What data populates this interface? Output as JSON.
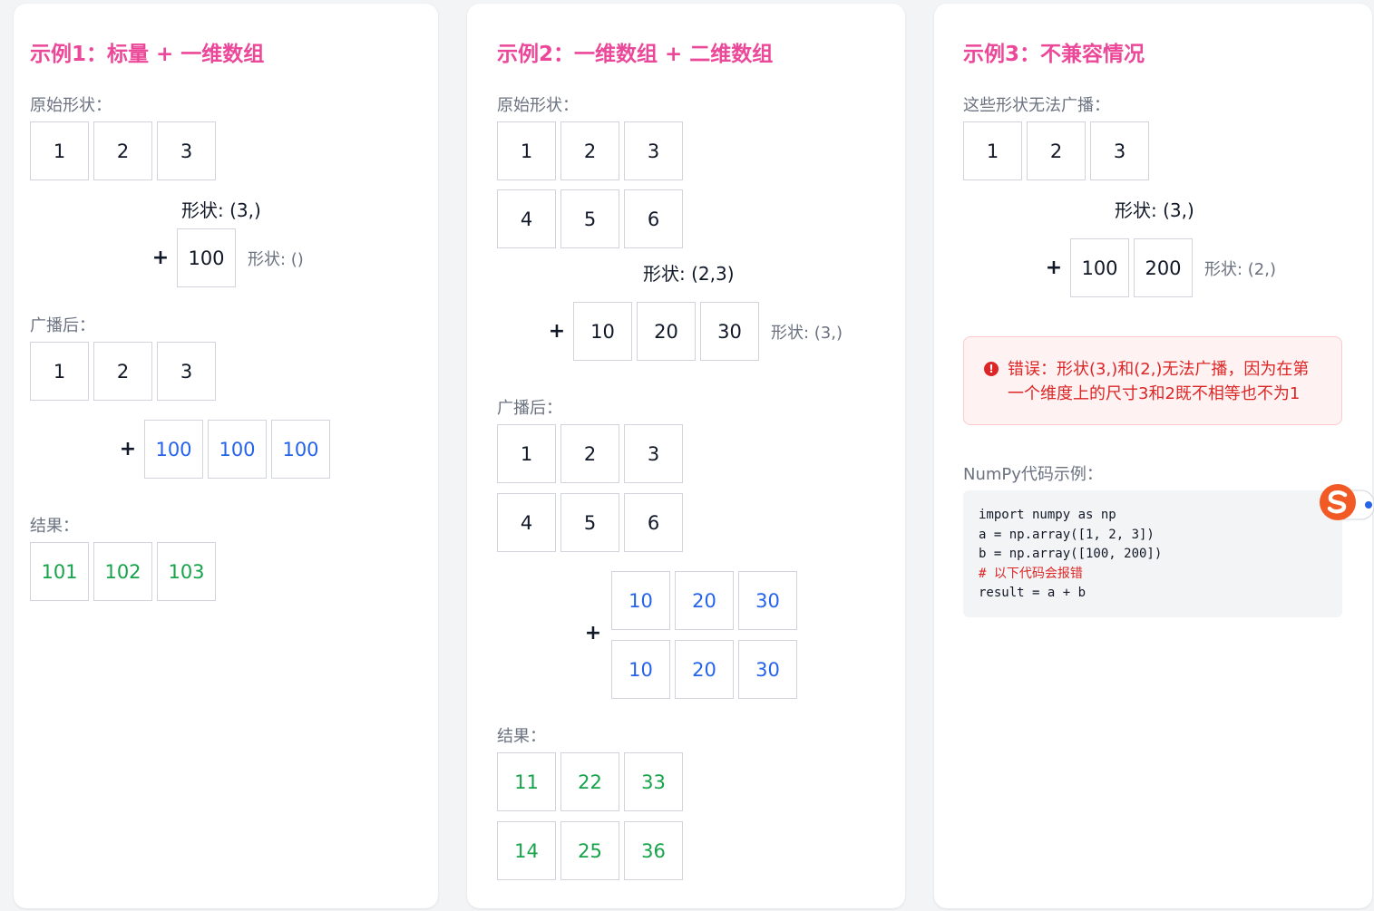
{
  "example1": {
    "title": "示例1：标量 + 一维数组",
    "original_label": "原始形状：",
    "a_values": [
      "1",
      "2",
      "3"
    ],
    "a_shape": "形状: (3,)",
    "plus": "+",
    "b_values": [
      "100"
    ],
    "b_shape": "形状: ()",
    "broadcast_label": "广播后：",
    "a_broadcast": [
      "1",
      "2",
      "3"
    ],
    "b_broadcast": [
      "100",
      "100",
      "100"
    ],
    "result_label": "结果：",
    "result": [
      "101",
      "102",
      "103"
    ]
  },
  "example2": {
    "title": "示例2：一维数组 + 二维数组",
    "original_label": "原始形状：",
    "a_rows": [
      [
        "1",
        "2",
        "3"
      ],
      [
        "4",
        "5",
        "6"
      ]
    ],
    "a_shape": "形状: (2,3)",
    "plus": "+",
    "b_values": [
      "10",
      "20",
      "30"
    ],
    "b_shape": "形状: (3,)",
    "broadcast_label": "广播后：",
    "a_broadcast_rows": [
      [
        "1",
        "2",
        "3"
      ],
      [
        "4",
        "5",
        "6"
      ]
    ],
    "b_broadcast_rows": [
      [
        "10",
        "20",
        "30"
      ],
      [
        "10",
        "20",
        "30"
      ]
    ],
    "result_label": "结果：",
    "result_rows": [
      [
        "11",
        "22",
        "33"
      ],
      [
        "14",
        "25",
        "36"
      ]
    ]
  },
  "example3": {
    "title": "示例3：不兼容情况",
    "intro_label": "这些形状无法广播：",
    "a_values": [
      "1",
      "2",
      "3"
    ],
    "a_shape": "形状: (3,)",
    "plus": "+",
    "b_values": [
      "100",
      "200"
    ],
    "b_shape": "形状: (2,)",
    "error_icon": "!",
    "error_text": "错误：形状(3,)和(2,)无法广播，因为在第一个维度上的尺寸3和2既不相等也不为1",
    "code_label": "NumPy代码示例：",
    "code_lines": [
      "import numpy as np",
      "a = np.array([1, 2, 3])",
      "b = np.array([100, 200])",
      "# 以下代码会报错",
      "result = a + b"
    ]
  },
  "colors": {
    "title": "#ec4899",
    "broadcast_value": "#2563eb",
    "result_value": "#16a34a",
    "error": "#dc2626"
  }
}
